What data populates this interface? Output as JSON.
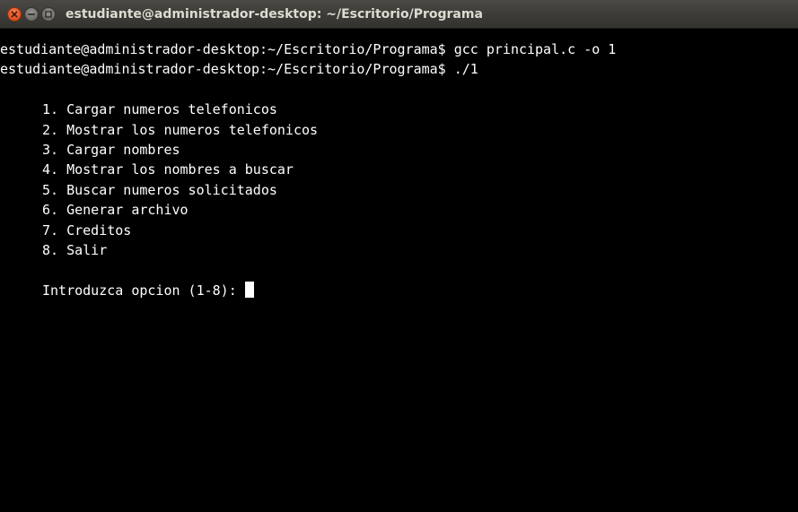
{
  "window": {
    "title": "estudiante@administrador-desktop: ~/Escritorio/Programa"
  },
  "terminal": {
    "lines": [
      "estudiante@administrador-desktop:~/Escritorio/Programa$ gcc principal.c -o 1",
      "estudiante@administrador-desktop:~/Escritorio/Programa$ ./1"
    ],
    "menu": [
      "1. Cargar numeros telefonicos",
      "2. Mostrar los numeros telefonicos",
      "3. Cargar nombres",
      "4. Mostrar los nombres a buscar",
      "5. Buscar numeros solicitados",
      "6. Generar archivo",
      "7. Creditos",
      "8. Salir"
    ],
    "prompt": "Introduzca opcion (1-8):"
  },
  "colors": {
    "background": "#000000",
    "text": "#ffffff",
    "titlebar": "#3c3b37",
    "close_button": "#e8582a"
  }
}
